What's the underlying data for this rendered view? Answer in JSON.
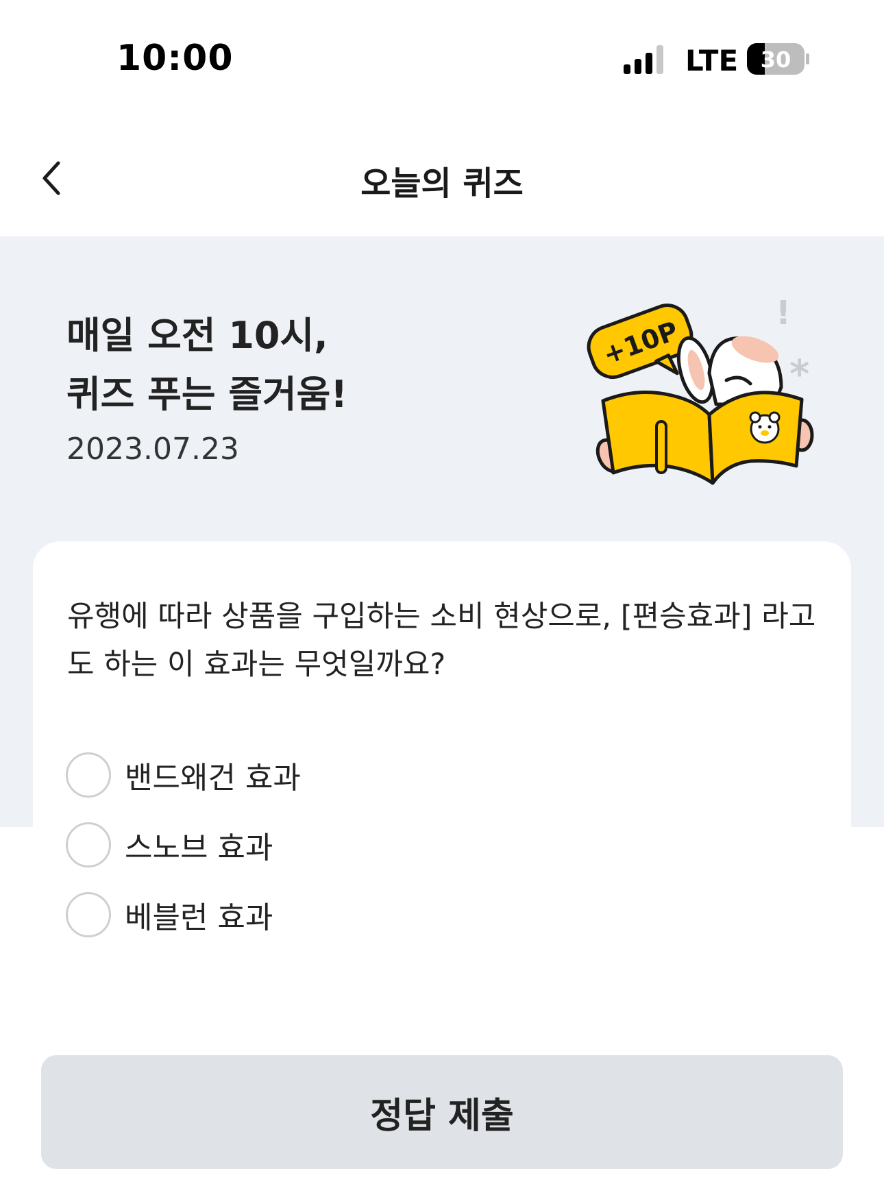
{
  "status_bar": {
    "time": "10:00",
    "network": "LTE",
    "battery": "30"
  },
  "nav": {
    "title": "오늘의 퀴즈"
  },
  "hero": {
    "headline_line1": "매일 오전 10시,",
    "headline_line2": "퀴즈 푸는 즐거움!",
    "date": "2023.07.23",
    "reward_badge": "+10P"
  },
  "quiz": {
    "question": "유행에 따라 상품을 구입하는 소비 현상으로, [편승효과] 라고도 하는 이 효과는 무엇일까요?",
    "options": [
      {
        "label": "밴드왜건 효과"
      },
      {
        "label": "스노브 효과"
      },
      {
        "label": "베블런 효과"
      }
    ]
  },
  "submit": {
    "label": "정답 제출"
  },
  "colors": {
    "hero_background": "#eef1f6",
    "book_yellow": "#ffc800",
    "button_background": "#dfe2e6",
    "radio_border": "#cfcfcf"
  },
  "icons": {
    "back": "chevron-left-icon",
    "signal": "cellular-signal-icon",
    "battery": "battery-icon",
    "illustration": "rabbit-reading-book-illustration"
  }
}
